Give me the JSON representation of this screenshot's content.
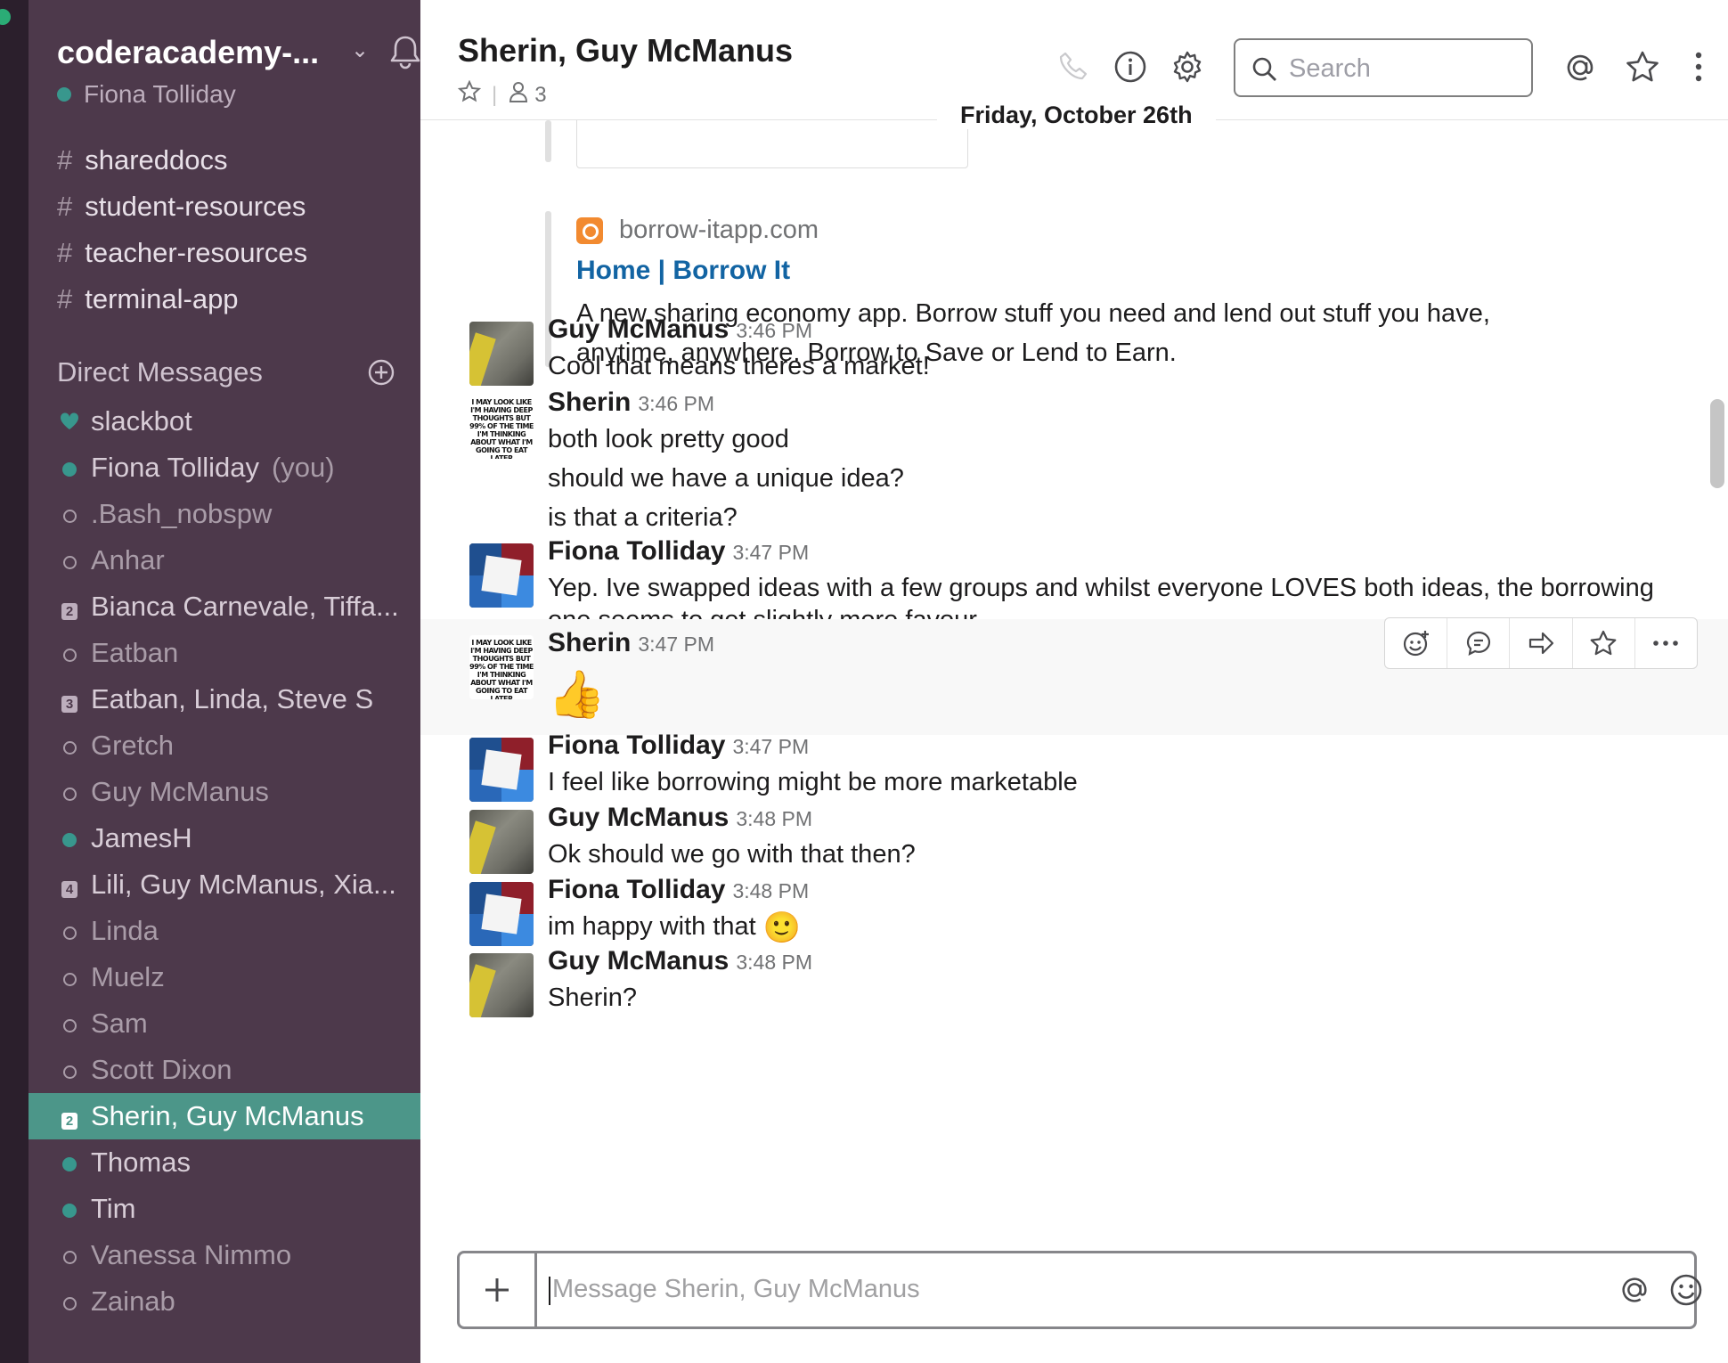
{
  "team": {
    "name": "coderacademy-...",
    "user": "Fiona Tolliday"
  },
  "channels": [
    "shareddocs",
    "student-resources",
    "teacher-resources",
    "terminal-app"
  ],
  "dm_title": "Direct Messages",
  "dms": [
    {
      "name": "slackbot",
      "status": "heart"
    },
    {
      "name": "Fiona Tolliday",
      "suffix": "(you)",
      "status": "online"
    },
    {
      "name": ".Bash_nobspw",
      "status": "away"
    },
    {
      "name": "Anhar",
      "status": "away"
    },
    {
      "name": "Bianca Carnevale, Tiffa...",
      "status": "group",
      "count": "2"
    },
    {
      "name": "Eatban",
      "status": "away"
    },
    {
      "name": "Eatban, Linda, Steve S",
      "status": "group",
      "count": "3"
    },
    {
      "name": "Gretch",
      "status": "away"
    },
    {
      "name": "Guy McManus",
      "status": "away"
    },
    {
      "name": "JamesH",
      "status": "online"
    },
    {
      "name": "Lili, Guy McManus, Xia...",
      "status": "group",
      "count": "4"
    },
    {
      "name": "Linda",
      "status": "away"
    },
    {
      "name": "Muelz",
      "status": "away"
    },
    {
      "name": "Sam",
      "status": "away"
    },
    {
      "name": "Scott Dixon",
      "status": "away"
    },
    {
      "name": "Sherin, Guy McManus",
      "status": "group",
      "count": "2",
      "active": true
    },
    {
      "name": "Thomas",
      "status": "online"
    },
    {
      "name": "Tim",
      "status": "online"
    },
    {
      "name": "Vanessa Nimmo",
      "status": "away"
    },
    {
      "name": "Zainab",
      "status": "away"
    }
  ],
  "header": {
    "title": "Sherin, Guy McManus",
    "member_count": "3",
    "search_placeholder": "Search"
  },
  "date_divider": "Friday, October 26th",
  "unfurl": {
    "site": "borrow-itapp.com",
    "title": "Home | Borrow It",
    "desc_line1": "A new sharing economy app. Borrow stuff you need and lend out stuff you have,",
    "desc_line2": "anytime, anywhere. Borrow to Save or Lend to Earn."
  },
  "sherin_avatar_text": "I MAY LOOK LIKE I'M HAVING DEEP THOUGHTS BUT 99% OF THE TIME I'M THINKING ABOUT WHAT I'M GOING TO EAT LATER",
  "messages": [
    {
      "author": "Guy McManus",
      "time": "3:46 PM",
      "lines": [
        "Cool that means theres a market!"
      ]
    },
    {
      "author": "Sherin",
      "time": "3:46 PM",
      "lines": [
        "both look pretty good",
        "should we have a unique idea?",
        "is that a criteria?"
      ]
    },
    {
      "author": "Fiona Tolliday",
      "time": "3:47 PM",
      "lines": [
        "Yep. Ive swapped ideas with a few groups and whilst everyone LOVES both ideas, the borrowing",
        "one seems to get slightly more favour"
      ]
    },
    {
      "author": "Sherin",
      "time": "3:47 PM",
      "emoji": "👍"
    },
    {
      "author": "Fiona Tolliday",
      "time": "3:47 PM",
      "lines": [
        "I feel like borrowing might be more marketable"
      ]
    },
    {
      "author": "Guy McManus",
      "time": "3:48 PM",
      "lines": [
        "Ok should we go with that then?"
      ]
    },
    {
      "author": "Fiona Tolliday",
      "time": "3:48 PM",
      "lines": [
        "im happy with that"
      ],
      "emoji": "🙂"
    },
    {
      "author": "Guy McManus",
      "time": "3:48 PM",
      "lines": [
        "Sherin?"
      ]
    }
  ],
  "composer": {
    "placeholder": "Message Sherin, Guy McManus"
  },
  "colors": {
    "sidebar": "#4d394b",
    "active": "#4c9689",
    "presence": "#38978d",
    "link": "#1264a3"
  }
}
